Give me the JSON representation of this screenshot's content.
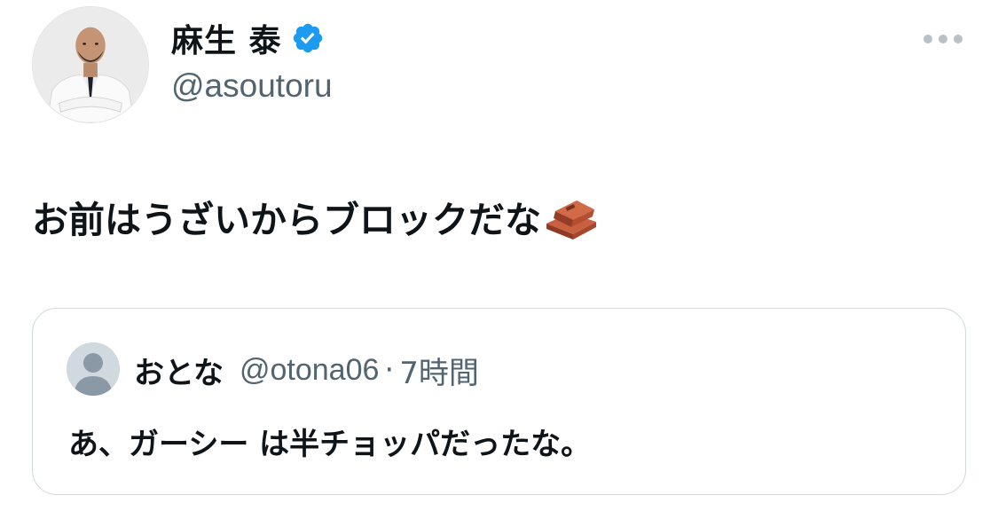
{
  "author": {
    "display_name": "麻生 泰",
    "handle": "@asoutoru",
    "verified": true,
    "verified_color": "#1d9bf0"
  },
  "tweet": {
    "text": "お前はうざいからブロックだな",
    "emoji": "brick-icon"
  },
  "quoted_tweet": {
    "display_name": "おとな",
    "handle": "@otona06",
    "separator": "·",
    "time": "7時間",
    "text": "あ、ガーシー は半チョッパだったな。"
  },
  "colors": {
    "text_primary": "#0f1419",
    "text_secondary": "#536471",
    "border": "#cfd9de"
  }
}
